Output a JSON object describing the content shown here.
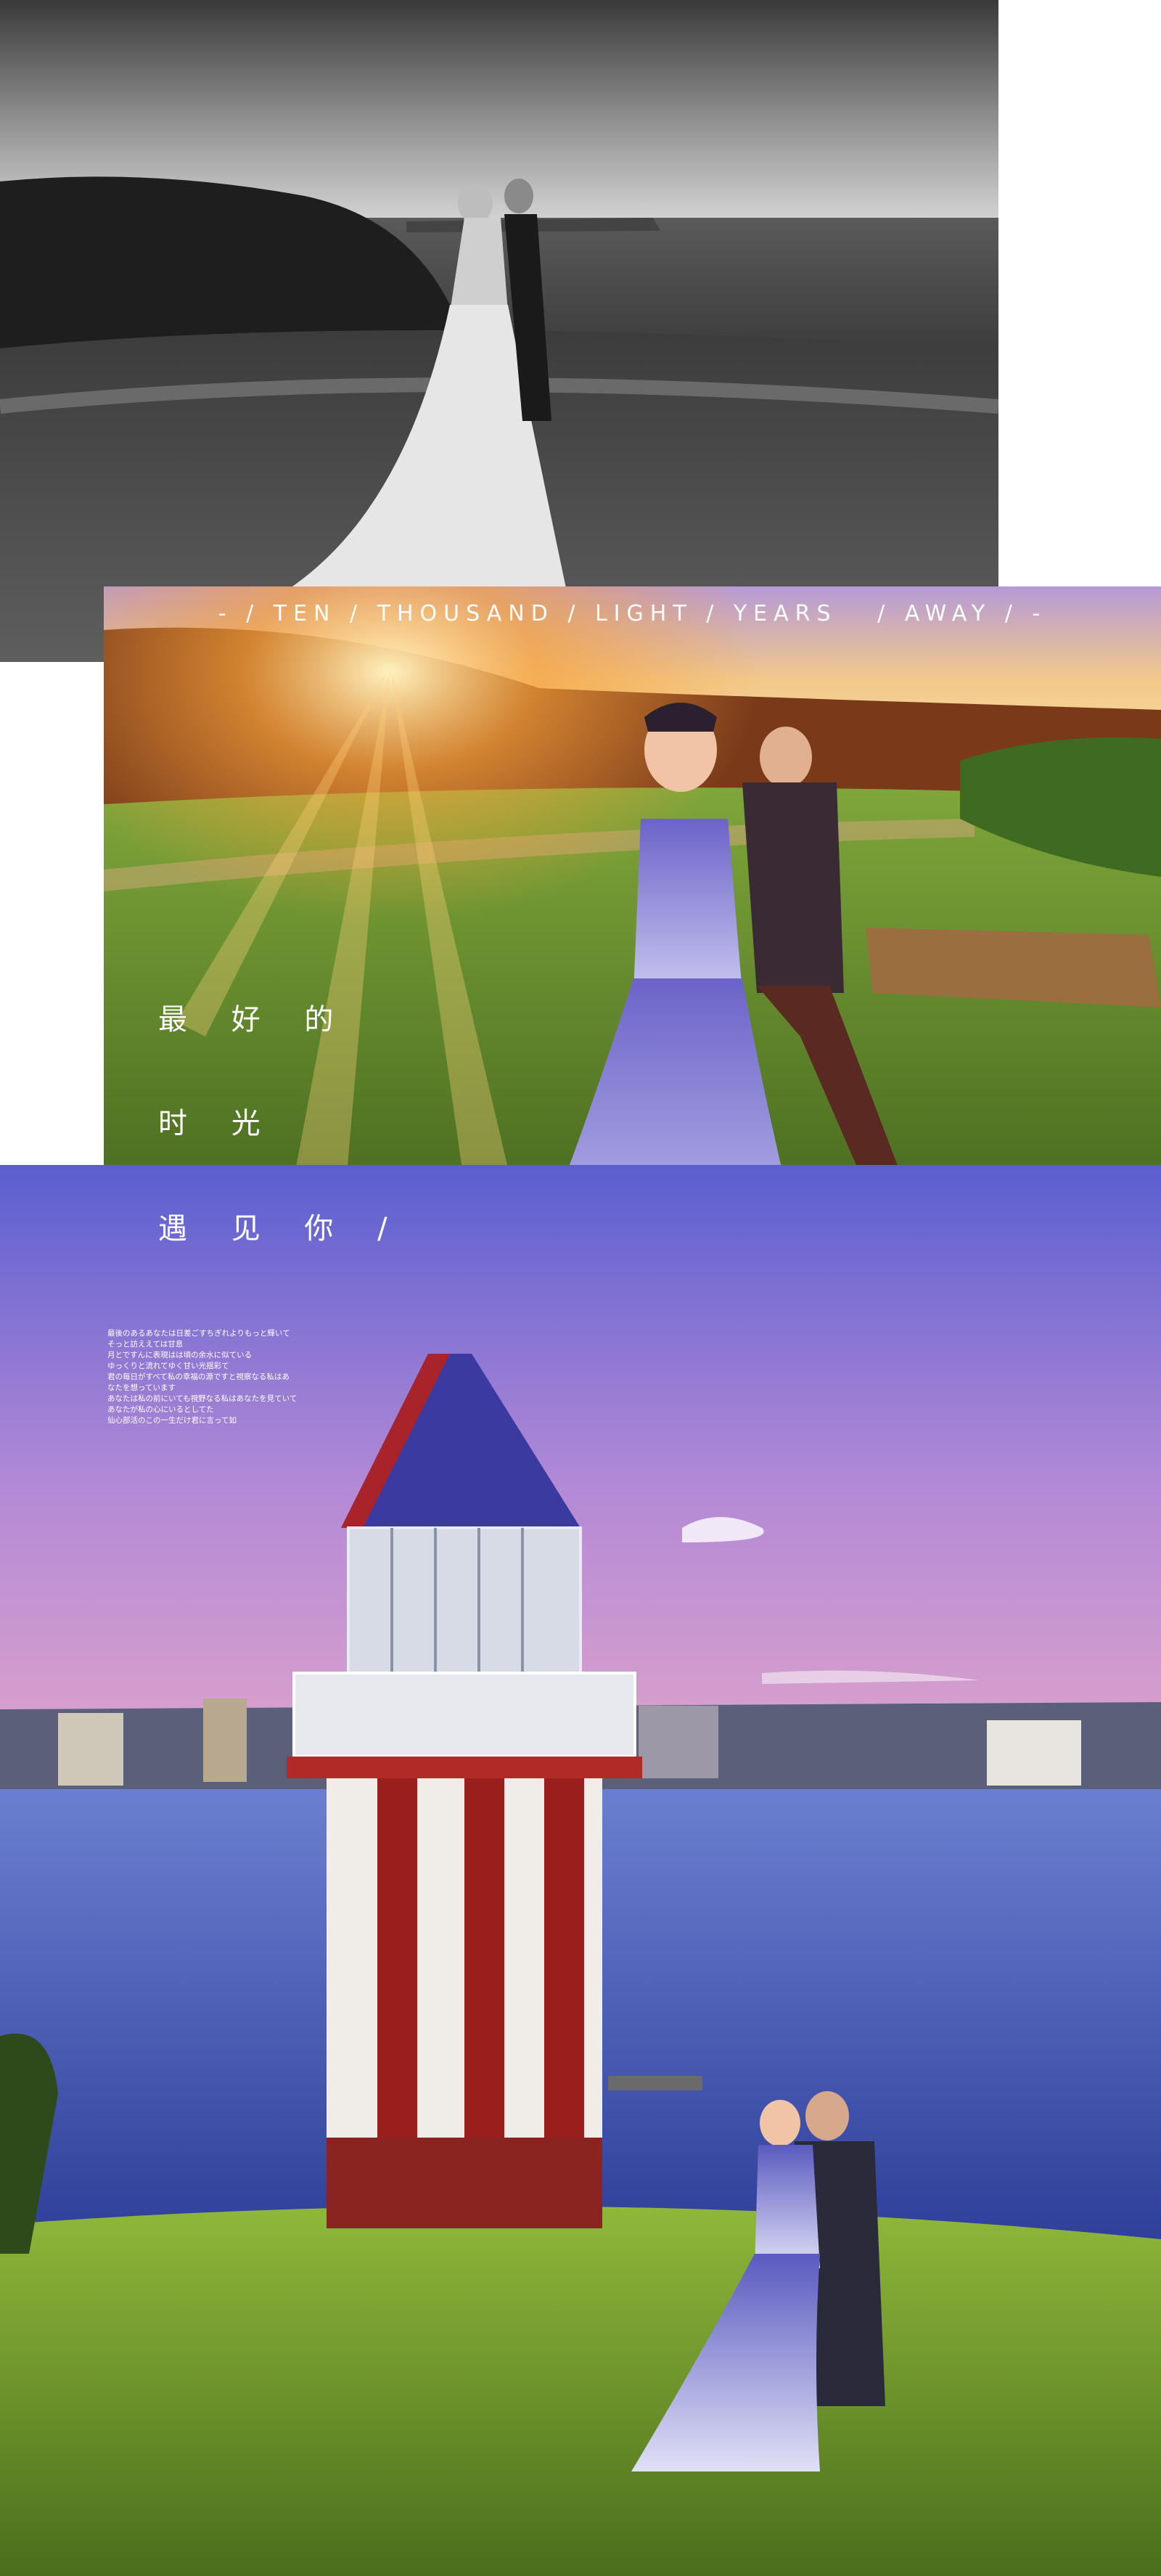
{
  "tagline": "- / TEN / THOUSAND / LIGHT / YEARS   / AWAY / -",
  "cn_lines": [
    "最 好 的",
    "时 光",
    "遇 见 你 /"
  ],
  "jp_lines": [
    "最後のあるあなたは日差ごすちぎれよりもっと輝いて",
    "そっと訪ええては甘息",
    "月とですんに表現はは頃の余水に似ている",
    "ゆっくりと流れてゆく甘い光揺彩て",
    "君の毎日がすべて私の幸福の源ですと視察なる私はあ",
    "なたを想っています",
    "あなたは私の前にいても視野なる私はあなたを見ていて",
    "あなたが私の心にいるとしてた",
    "仙心部活のこの一生だけ君に言って如"
  ],
  "colors": {
    "sunset_sky": "#f2b66a",
    "grass_green": "#5b8a2a",
    "sky_purple": "#8a6fc9",
    "sea_blue": "#4a5aa8",
    "lighthouse_red": "#8a1f1a"
  }
}
